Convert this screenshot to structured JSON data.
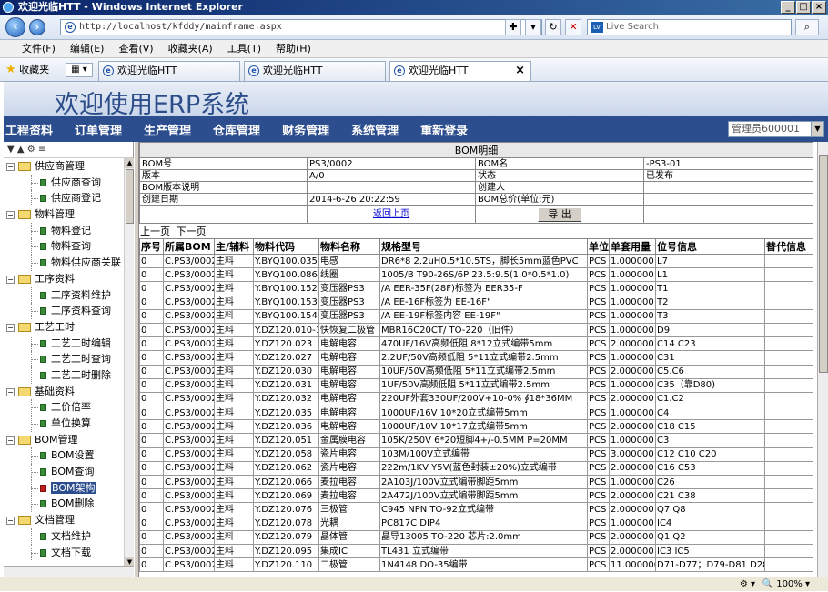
{
  "window": {
    "title": "欢迎光临HTT - Windows Internet Explorer"
  },
  "address": {
    "url": "http://localhost/kfddy/mainframe.aspx",
    "search_placeholder": "Live Search"
  },
  "ie_menu": [
    "文件(F)",
    "编辑(E)",
    "查看(V)",
    "收藏夹(A)",
    "工具(T)",
    "帮助(H)"
  ],
  "favbar": {
    "favorites": "收藏夹",
    "tabs": [
      "欢迎光临HTT",
      "欢迎光临HTT",
      "欢迎光临HTT"
    ]
  },
  "banner": {
    "title": "欢迎使用ERP系统"
  },
  "main_menu": [
    "工程资料",
    "订单管理",
    "生产管理",
    "仓库管理",
    "财务管理",
    "系统管理",
    "重新登录"
  ],
  "admin": {
    "value": "管理员600001"
  },
  "tree": [
    {
      "group": "供应商管理",
      "items": [
        "供应商查询",
        "供应商登记"
      ]
    },
    {
      "group": "物料管理",
      "items": [
        "物料登记",
        "物料查询",
        "物料供应商关联"
      ]
    },
    {
      "group": "工序资料",
      "items": [
        "工序资料维护",
        "工序资料查询"
      ]
    },
    {
      "group": "工艺工时",
      "items": [
        "工艺工时编辑",
        "工艺工时查询",
        "工艺工时删除"
      ]
    },
    {
      "group": "基础资料",
      "items": [
        "工价倍率",
        "单位换算"
      ]
    },
    {
      "group": "BOM管理",
      "items": [
        "BOM设置",
        "BOM查询",
        "BOM架构",
        "BOM删除"
      ]
    },
    {
      "group": "文档管理",
      "items": [
        "文档维护",
        "文档下载"
      ]
    }
  ],
  "bom": {
    "title": "BOM明细",
    "bom_no_label": "BOM号",
    "bom_no": "PS3/0002",
    "bom_name_label": "BOM名",
    "bom_name": "-PS3-01",
    "version_label": "版本",
    "version": "A/0",
    "status_label": "状态",
    "status": "已发布",
    "desc_label": "BOM版本说明",
    "creator_label": "创建人",
    "date_label": "创建日期",
    "date": "2014-6-26 20:22:59",
    "price_label": "BOM总价(单位:元)",
    "back_link": "返回上页",
    "export_button": "导 出"
  },
  "pager": {
    "prev": "上一页",
    "next": "下一页"
  },
  "columns": [
    "序号",
    "所属BOM",
    "主/辅料",
    "物料代码",
    "物料名称",
    "规格型号",
    "单位",
    "单套用量",
    "位号信息",
    "替代信息"
  ],
  "rows": [
    [
      "0",
      "C.PS3/0002",
      "主料",
      "Y.BYQ100.035",
      "电感",
      "DR6*8 2.2uH0.5*10.5TS，脚长5mm蓝色PVC",
      "PCS",
      "1.000000",
      "L7",
      ""
    ],
    [
      "0",
      "C.PS3/0002",
      "主料",
      "Y.BYQ100.086",
      "线圈",
      "1005/B T90-26S/6P 23.5:9.5(1.0*0.5*1.0)",
      "PCS",
      "1.000000",
      "L1",
      ""
    ],
    [
      "0",
      "C.PS3/0002",
      "主料",
      "Y.BYQ100.152",
      "变压器PS3",
      "/A EER-35F(28F)标签为 EER35-F",
      "PCS",
      "1.000000",
      "T1",
      ""
    ],
    [
      "0",
      "C.PS3/0002",
      "主料",
      "Y.BYQ100.153",
      "变压器PS3",
      "/A EE-16F标签为 EE-16F\"",
      "PCS",
      "1.000000",
      "T2",
      ""
    ],
    [
      "0",
      "C.PS3/0002",
      "主料",
      "Y.BYQ100.154",
      "变压器PS3",
      "/A EE-19F标签内容 EE-19F\"",
      "PCS",
      "1.000000",
      "T3",
      ""
    ],
    [
      "0",
      "C.PS3/0002",
      "主料",
      "Y.DZ120.010-1",
      "快恢复二极管",
      "MBR16C20CT/ TO-220（旧件）",
      "PCS",
      "1.000000",
      "D9",
      ""
    ],
    [
      "0",
      "C.PS3/0002",
      "主料",
      "Y.DZ120.023",
      "电解电容",
      "470UF/16V高频低阻 8*12立式编带5mm",
      "PCS",
      "2.000000",
      "C14 C23",
      ""
    ],
    [
      "0",
      "C.PS3/0002",
      "主料",
      "Y.DZ120.027",
      "电解电容",
      "2.2UF/50V高频低阻 5*11立式编带2.5mm",
      "PCS",
      "1.000000",
      "C31",
      ""
    ],
    [
      "0",
      "C.PS3/0002",
      "主料",
      "Y.DZ120.030",
      "电解电容",
      "10UF/50V高频低阻 5*11立式编带2.5mm",
      "PCS",
      "2.000000",
      "C5.C6",
      ""
    ],
    [
      "0",
      "C.PS3/0002",
      "主料",
      "Y.DZ120.031",
      "电解电容",
      "1UF/50V高频低阻 5*11立式编带2.5mm",
      "PCS",
      "1.000000",
      "C35（靠D80)",
      ""
    ],
    [
      "0",
      "C.PS3/0002",
      "主料",
      "Y.DZ120.032",
      "电解电容",
      "220UF外套330UF/200V+10-0% ∮18*36MM",
      "PCS",
      "2.000000",
      "C1.C2",
      ""
    ],
    [
      "0",
      "C.PS3/0002",
      "主料",
      "Y.DZ120.035",
      "电解电容",
      "1000UF/16V 10*20立式编带5mm",
      "PCS",
      "1.000000",
      "C4",
      ""
    ],
    [
      "0",
      "C.PS3/0002",
      "主料",
      "Y.DZ120.036",
      "电解电容",
      "1000UF/10V 10*17立式编带5mm",
      "PCS",
      "2.000000",
      "C18 C15",
      ""
    ],
    [
      "0",
      "C.PS3/0002",
      "主料",
      "Y.DZ120.051",
      "金属膜电容",
      "105K/250V 6*20短脚4+/-0.5MM P=20MM",
      "PCS",
      "1.000000",
      "C3",
      ""
    ],
    [
      "0",
      "C.PS3/0002",
      "主料",
      "Y.DZ120.058",
      "瓷片电容",
      "103M/100V立式编带",
      "PCS",
      "3.000000",
      "C12 C10 C20",
      ""
    ],
    [
      "0",
      "C.PS3/0002",
      "主料",
      "Y.DZ120.062",
      "瓷片电容",
      "222m/1KV Y5V(蓝色封装±20%)立式编带",
      "PCS",
      "2.000000",
      "C16 C53",
      ""
    ],
    [
      "0",
      "C.PS3/0002",
      "主料",
      "Y.DZ120.066",
      "麦拉电容",
      "2A103J/100V立式编带脚距5mm",
      "PCS",
      "1.000000",
      "C26",
      ""
    ],
    [
      "0",
      "C.PS3/0002",
      "主料",
      "Y.DZ120.069",
      "麦拉电容",
      "2A472J/100V立式编带脚距5mm",
      "PCS",
      "2.000000",
      "C21 C38",
      ""
    ],
    [
      "0",
      "C.PS3/0002",
      "主料",
      "Y.DZ120.076",
      "三极管",
      "C945 NPN TO-92立式编带",
      "PCS",
      "2.000000",
      "Q7 Q8",
      ""
    ],
    [
      "0",
      "C.PS3/0002",
      "主料",
      "Y.DZ120.078",
      "光耦",
      "PC817C DIP4",
      "PCS",
      "1.000000",
      "IC4",
      ""
    ],
    [
      "0",
      "C.PS3/0002",
      "主料",
      "Y.DZ120.079",
      "晶体管",
      "晶导13005 TO-220 芯片:2.0mm",
      "PCS",
      "2.000000",
      "Q1 Q2",
      ""
    ],
    [
      "0",
      "C.PS3/0002",
      "主料",
      "Y.DZ120.095",
      "集成IC",
      "TL431 立式编带",
      "PCS",
      "2.000000",
      "IC3 IC5",
      ""
    ],
    [
      "0",
      "C.PS3/0002",
      "主料",
      "Y.DZ120.110",
      "二极管",
      "1N4148 DO-35编带",
      "PCS",
      "11.000000",
      "D71-D77；D79-D81 D28",
      ""
    ]
  ],
  "statusbar": {
    "zoom": "100%"
  }
}
